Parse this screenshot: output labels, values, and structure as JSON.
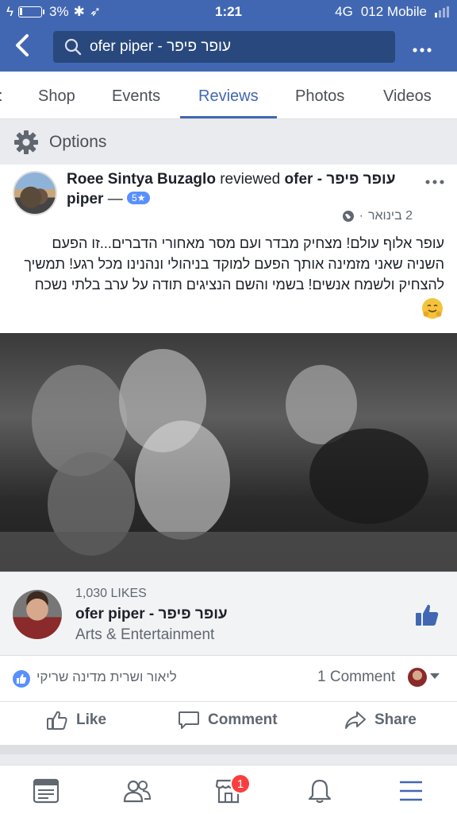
{
  "status_bar": {
    "battery_percent": "3%",
    "time": "1:21",
    "network": "4G",
    "carrier": "012 Mobile"
  },
  "header": {
    "search_text": "ofer piper - עופר פיפר"
  },
  "tabs": [
    {
      "label": ":"
    },
    {
      "label": "Shop"
    },
    {
      "label": "Events"
    },
    {
      "label": "Reviews",
      "active": true
    },
    {
      "label": "Photos"
    },
    {
      "label": "Videos"
    }
  ],
  "options": {
    "label": "Options"
  },
  "post": {
    "author": "Roee Sintya Buzaglo",
    "action": "reviewed",
    "target": "ofer - עופר פיפר piper",
    "dash": "—",
    "rating": "5★",
    "date": "2 בינואר",
    "dot": "·",
    "body": "עופר אלוף עולם! מצחיק מבדר ועם מסר מאחורי הדברים...זו הפעם השניה שאני מזמינה אותך הפעם למוקד בניהולי ונהנינו מכל רגע! תמשיך להצחיק ולשמח אנשים! בשמי והשם הנציגים תודה על ערב בלתי נשכח"
  },
  "page_share": {
    "likes": "1,030 LIKES",
    "name": "ofer piper - עופר פיפר",
    "category": "Arts & Entertainment"
  },
  "reactions": {
    "names": "ליאור ושרית מדינה שריקי",
    "comments": "1 Comment"
  },
  "actions": {
    "like": "Like",
    "comment": "Comment",
    "share": "Share"
  },
  "bottom_nav": {
    "marketplace_badge": "1"
  },
  "colors": {
    "brand_blue": "#4267b2",
    "badge_red": "#fa3e3e"
  }
}
